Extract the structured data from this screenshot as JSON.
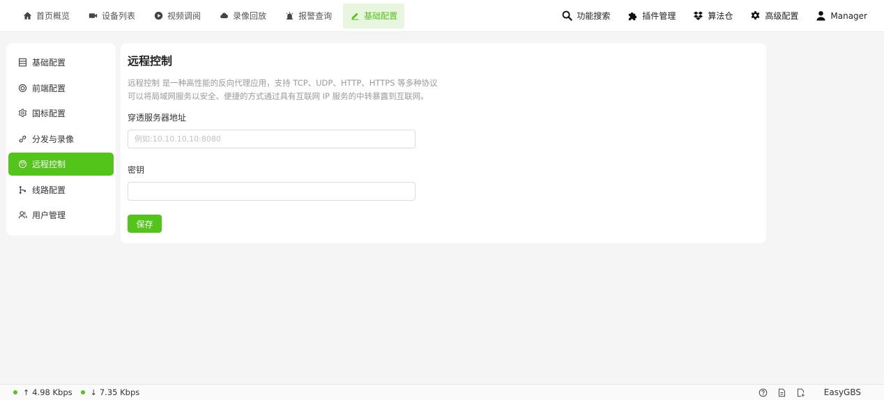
{
  "nav": {
    "items": [
      {
        "label": "首页概览",
        "icon": "home-icon"
      },
      {
        "label": "设备列表",
        "icon": "camera-icon"
      },
      {
        "label": "视频调阅",
        "icon": "play-circle-icon"
      },
      {
        "label": "录像回放",
        "icon": "cloud-icon"
      },
      {
        "label": "报警查询",
        "icon": "alarm-icon"
      },
      {
        "label": "基础配置",
        "icon": "edit-icon",
        "active": true
      }
    ],
    "right": [
      {
        "label": "功能搜索",
        "icon": "search-icon"
      },
      {
        "label": "插件管理",
        "icon": "puzzle-icon"
      },
      {
        "label": "算法仓",
        "icon": "dropbox-icon"
      },
      {
        "label": "高级配置",
        "icon": "gear-icon"
      },
      {
        "label": "Manager",
        "icon": "user-icon"
      }
    ]
  },
  "sidebar": {
    "items": [
      {
        "label": "基础配置",
        "icon": "list-icon"
      },
      {
        "label": "前端配置",
        "icon": "target-icon"
      },
      {
        "label": "国标配置",
        "icon": "settings-icon"
      },
      {
        "label": "分发与录像",
        "icon": "link-icon"
      },
      {
        "label": "远程控制",
        "icon": "remote-icon",
        "active": true
      },
      {
        "label": "线路配置",
        "icon": "branch-icon"
      },
      {
        "label": "用户管理",
        "icon": "users-icon"
      }
    ]
  },
  "panel": {
    "title": "远程控制",
    "desc_line1": "远程控制 是一种高性能的反向代理应用，支持 TCP、UDP、HTTP、HTTPS 等多种协议",
    "desc_line2": "可以将局域网服务以安全、便捷的方式通过具有互联网 IP 服务的中转暴露到互联网。",
    "server_label": "穿透服务器地址",
    "server_placeholder": "例如:10.10.10.10:8080",
    "server_value": "",
    "secret_label": "密钥",
    "secret_value": "",
    "save_label": "保存"
  },
  "status": {
    "up": "4.98 Kbps",
    "down": "7.35 Kbps",
    "brand": "EasyGBS"
  },
  "colors": {
    "accent": "#52c41a",
    "accent_light": "#e8f6df"
  }
}
